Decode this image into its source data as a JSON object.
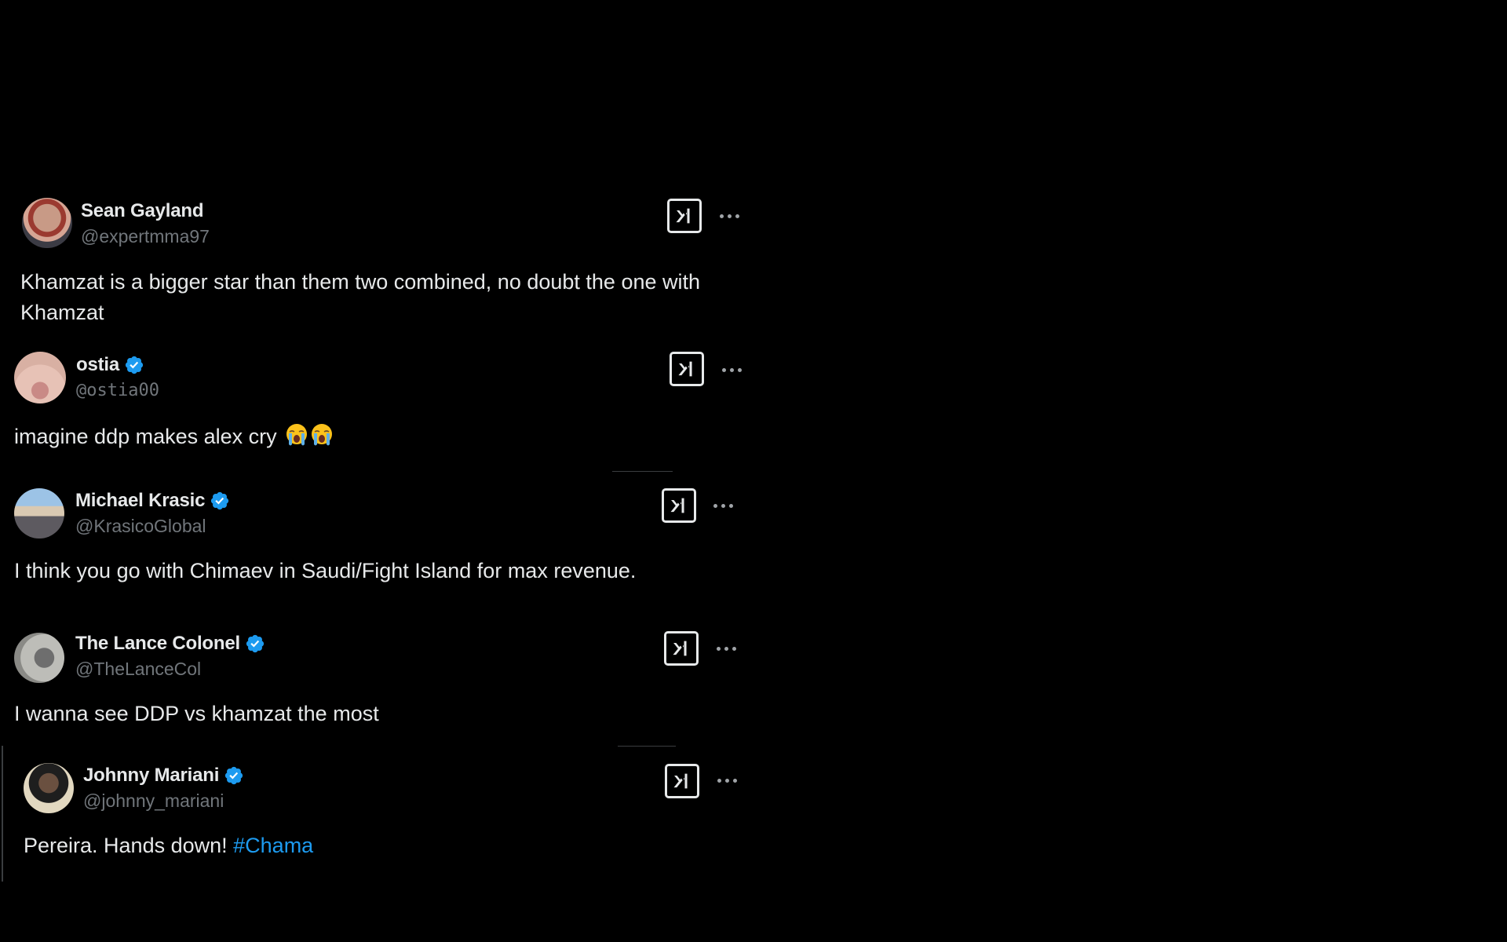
{
  "tweets": [
    {
      "name": "Sean Gayland",
      "handle": "@expertmma97",
      "verified": false,
      "text": "Khamzat is a bigger star than them two combined, no doubt the one with Khamzat",
      "icons": {
        "grok": "grok-xai-icon",
        "more": "more-options-icon"
      }
    },
    {
      "name": "ostia",
      "handle": "@ostia00",
      "verified": true,
      "text": "imagine ddp makes alex cry",
      "emojis": [
        "loudly-crying-face",
        "loudly-crying-face"
      ],
      "icons": {
        "grok": "grok-xai-icon",
        "more": "more-options-icon"
      }
    },
    {
      "name": "Michael Krasic",
      "handle": "@KrasicoGlobal",
      "verified": true,
      "text": "I think you go with Chimaev in Saudi/Fight Island for max revenue.",
      "icons": {
        "grok": "grok-xai-icon",
        "more": "more-options-icon"
      }
    },
    {
      "name": "The Lance Colonel",
      "handle": "@TheLanceCol",
      "verified": true,
      "text": "I wanna see DDP vs khamzat the most",
      "icons": {
        "grok": "grok-xai-icon",
        "more": "more-options-icon"
      }
    },
    {
      "name": "Johnny Mariani",
      "handle": "@johnny_mariani",
      "verified": true,
      "text": "Pereira. Hands down! ",
      "hashtag": "#Chama",
      "icons": {
        "grok": "grok-xai-icon",
        "more": "more-options-icon"
      }
    }
  ],
  "colors": {
    "background": "#000000",
    "text": "#e7e9ea",
    "handle": "#71767b",
    "verified": "#1d9bf0",
    "hashtag": "#1d9bf0"
  }
}
